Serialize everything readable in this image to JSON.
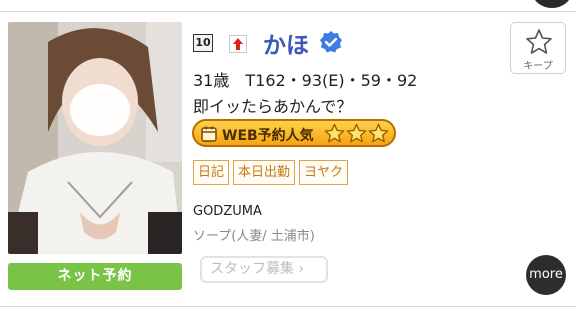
{
  "card": {
    "rank": "10",
    "name": "かほ",
    "stats": "31歳　T162・93(E)・59・92",
    "catchphrase": "即イッたらあかんで？",
    "web_badge": "WEB予約人気",
    "web_badge_stars": 3,
    "tags": [
      "日記",
      "本日出勤",
      "ヨヤク"
    ],
    "shop": "GODZUMA",
    "genre": "ソープ(人妻/ 土浦市)",
    "keep_label": "キープ",
    "net_reserve_label": "ネット予約",
    "staff_label": "スタッフ募集",
    "more_label": "more"
  },
  "colors": {
    "name": "#3b57b8",
    "verified": "#3b7de0",
    "net_reserve": "#79c346",
    "tag": "#c77a10",
    "badge": "#f5a413"
  },
  "icons": [
    "rank-up-icon",
    "verified-icon",
    "star-outline-icon",
    "calendar-icon",
    "star-icon",
    "chevron-right-icon"
  ]
}
